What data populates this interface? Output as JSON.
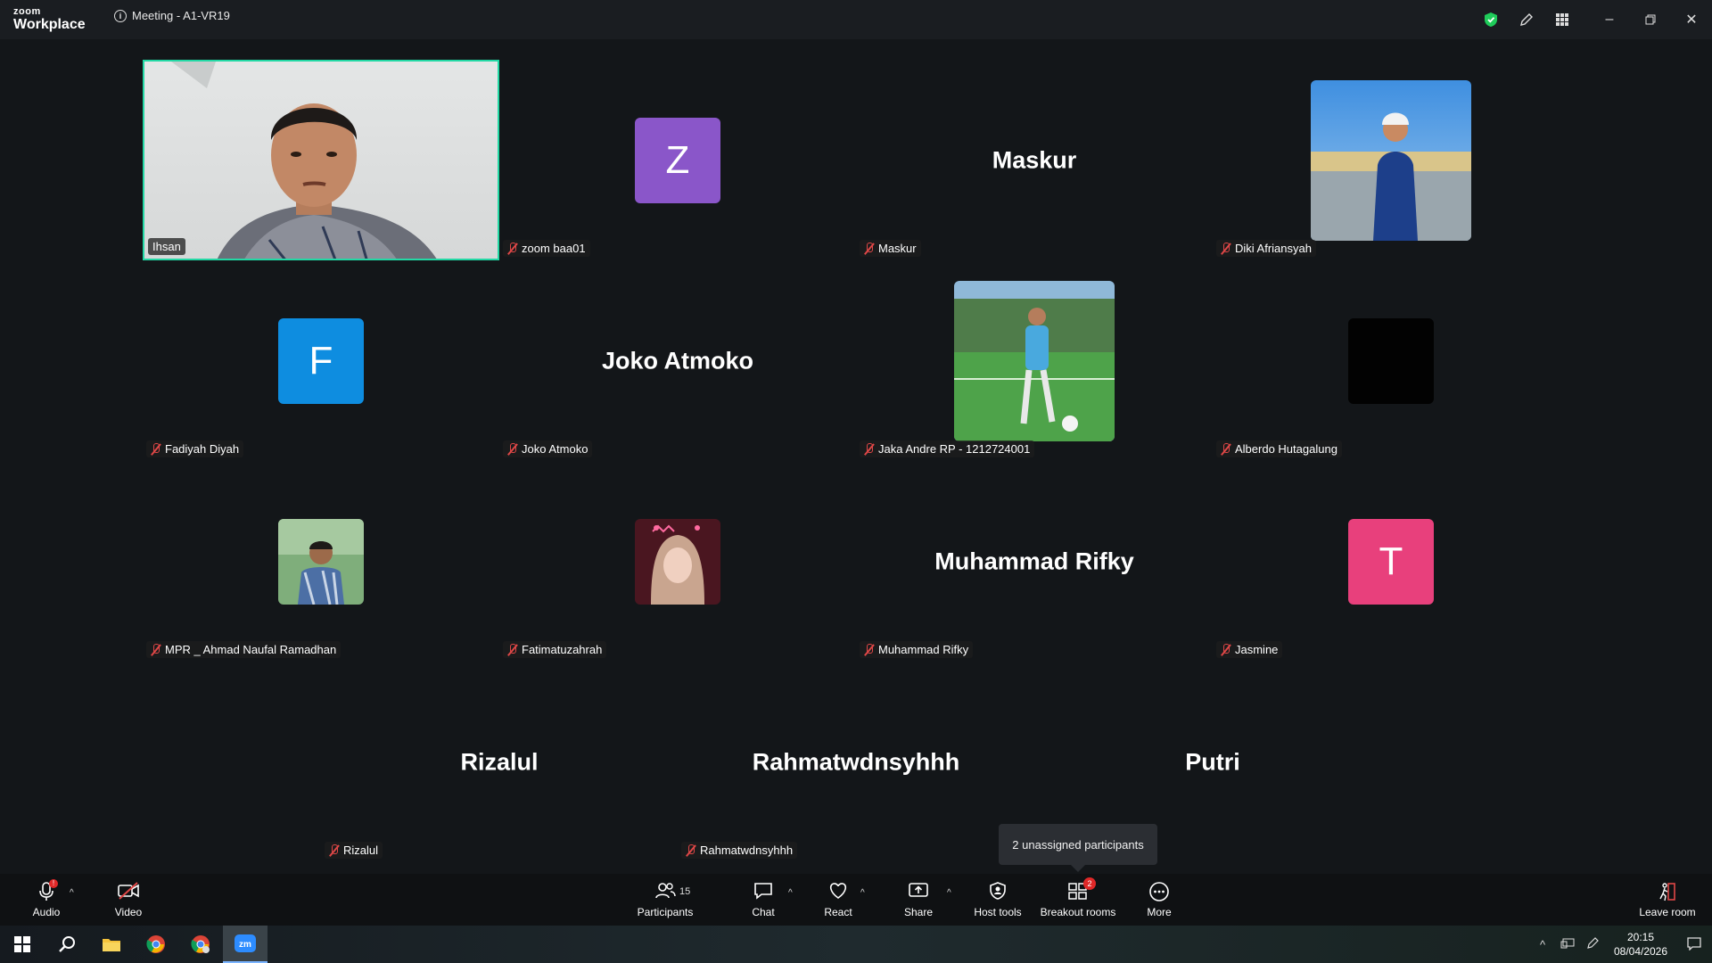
{
  "titlebar": {
    "brand_small": "zoom",
    "brand_large": "Workplace",
    "meeting_title": "Meeting - A1-VR19"
  },
  "participants": [
    {
      "name": "Ihsan",
      "display": "video",
      "active": true
    },
    {
      "name": "zoom baa01",
      "display": "avatar",
      "letter": "Z",
      "color": "#8a56c9"
    },
    {
      "name": "Maskur",
      "display": "name",
      "big_name": "Maskur"
    },
    {
      "name": "Diki Afriansyah",
      "display": "photo"
    },
    {
      "name": "Fadiyah Diyah",
      "display": "avatar",
      "letter": "F",
      "color": "#0e8de0"
    },
    {
      "name": "Joko Atmoko",
      "display": "name",
      "big_name": "Joko Atmoko"
    },
    {
      "name": "Jaka Andre RP - 1212724001",
      "display": "photo"
    },
    {
      "name": "Alberdo Hutagalung",
      "display": "photo"
    },
    {
      "name": "MPR _ Ahmad Naufal Ramadhan",
      "display": "photo"
    },
    {
      "name": "Fatimatuzahrah",
      "display": "photo"
    },
    {
      "name": "Muhammad Rifky",
      "display": "name",
      "big_name": "Muhammad Rifky"
    },
    {
      "name": "Jasmine",
      "display": "avatar",
      "letter": "T",
      "color": "#e8407c"
    },
    {
      "name": "Rizalul",
      "display": "name",
      "big_name": "Rizalul"
    },
    {
      "name": "Rahmatwdnsyhhh",
      "display": "name",
      "big_name": "Rahmatwdnsyhhh"
    },
    {
      "name": "Putri",
      "display": "name",
      "big_name": "Putri"
    }
  ],
  "tooltip": "2 unassigned participants",
  "toolbar": {
    "audio": "Audio",
    "video": "Video",
    "participants": "Participants",
    "participants_count": "15",
    "chat": "Chat",
    "react": "React",
    "share": "Share",
    "host_tools": "Host tools",
    "breakout_rooms": "Breakout rooms",
    "breakout_badge": "2",
    "more": "More",
    "leave_room": "Leave room"
  },
  "taskbar": {
    "time": "20:15",
    "date": "08/04/2026"
  },
  "colors": {
    "active_border": "#23d9a5",
    "muted_mic": "#e04747",
    "bg": "#131619"
  }
}
